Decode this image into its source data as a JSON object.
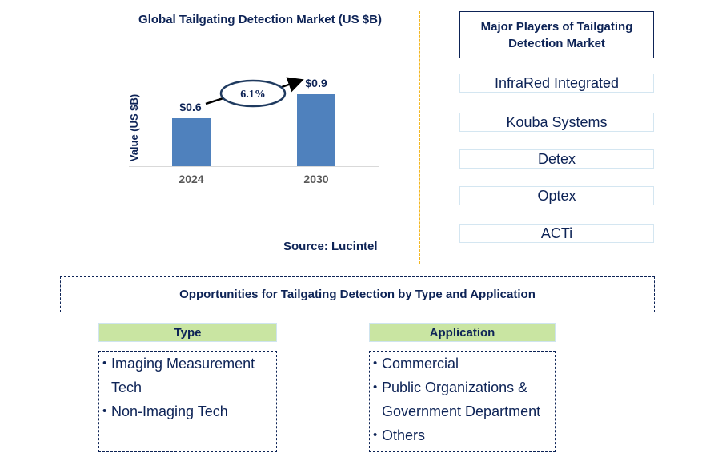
{
  "chart_data": {
    "type": "bar",
    "title": "Global Tailgating Detection Market (US $B)",
    "xlabel": "",
    "ylabel": "Value (US $B)",
    "categories": [
      "2024",
      "2030"
    ],
    "values": [
      0.6,
      0.9
    ],
    "data_labels": [
      "$0.6",
      "$0.9"
    ],
    "ylim": [
      0,
      1.05
    ],
    "grid": false,
    "bar_color": "#4f81bd",
    "annotation": {
      "text": "6.1%",
      "meaning": "CAGR from 2024 to 2030"
    },
    "source": "Source: Lucintel"
  },
  "players": {
    "header": "Major Players of Tailgating Detection Market",
    "items": [
      "InfraRed Integrated",
      "Kouba Systems",
      "Detex",
      "Optex",
      "ACTi"
    ]
  },
  "opportunities": {
    "title": "Opportunities for Tailgating Detection by Type and Application",
    "type": {
      "header": "Type",
      "items": [
        "Imaging Measurement Tech",
        "Non-Imaging Tech"
      ]
    },
    "application": {
      "header": "Application",
      "items": [
        "Commercial",
        "Public Organizations & Government Department",
        "Others"
      ]
    }
  },
  "colors": {
    "text": "#0d2356",
    "bar": "#4f81bd",
    "divider": "#f3b61f",
    "category_header_bg": "#c9e5a2"
  }
}
